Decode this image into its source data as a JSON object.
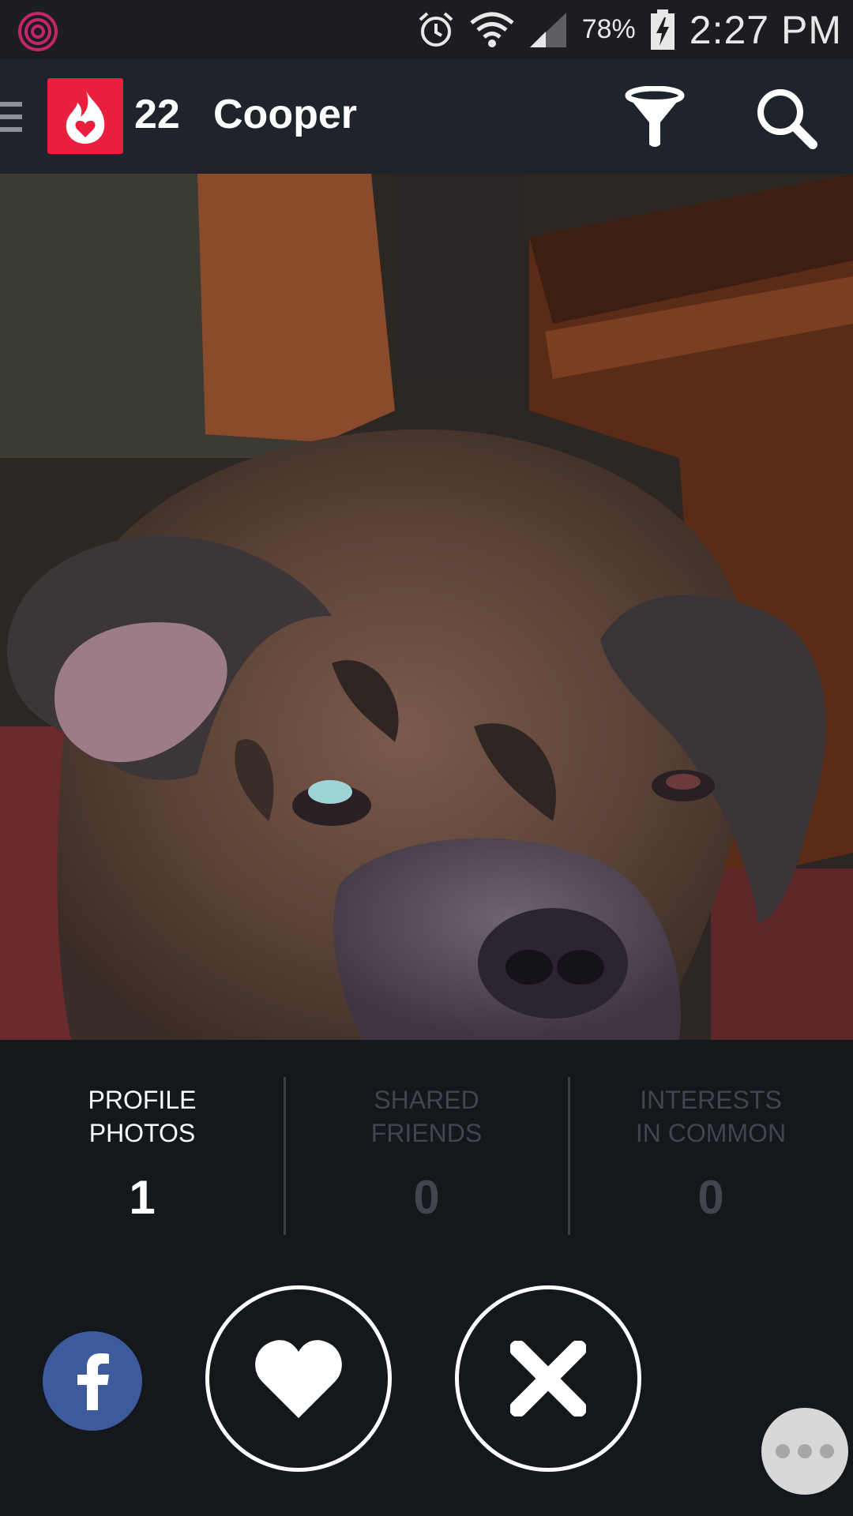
{
  "status_bar": {
    "battery_percent": "78%",
    "time": "2:27 PM",
    "icons": [
      "app-notification-icon",
      "alarm-icon",
      "wifi-icon",
      "signal-icon",
      "battery-charging-icon"
    ]
  },
  "header": {
    "logo_icon": "flame-heart-logo-icon",
    "age": "22",
    "name": "Cooper",
    "filter_icon": "filter-funnel-icon",
    "search_icon": "search-icon",
    "accent_color": "#ea1f3d"
  },
  "stats": [
    {
      "label": "PROFILE\nPHOTOS",
      "value": "1",
      "active": true
    },
    {
      "label": "SHARED\nFRIENDS",
      "value": "0",
      "active": false
    },
    {
      "label": "INTERESTS\nIN COMMON",
      "value": "0",
      "active": false
    }
  ],
  "actions": {
    "facebook_icon": "facebook-icon",
    "like_icon": "heart-icon",
    "dislike_icon": "close-icon",
    "more_icon": "more-dots-icon",
    "facebook_color": "#3d5a9c"
  }
}
